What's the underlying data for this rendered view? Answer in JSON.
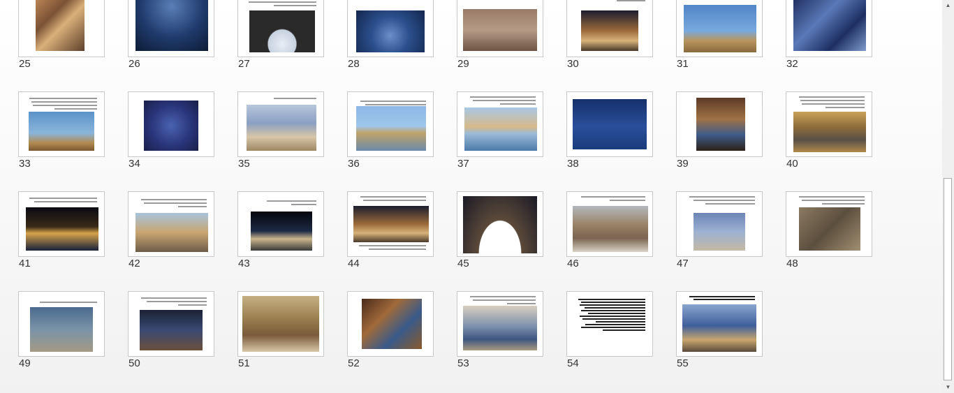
{
  "slides": [
    {
      "number": "25"
    },
    {
      "number": "26"
    },
    {
      "number": "27"
    },
    {
      "number": "28"
    },
    {
      "number": "29"
    },
    {
      "number": "30"
    },
    {
      "number": "31"
    },
    {
      "number": "32"
    },
    {
      "number": "33"
    },
    {
      "number": "34"
    },
    {
      "number": "35"
    },
    {
      "number": "36"
    },
    {
      "number": "37"
    },
    {
      "number": "38"
    },
    {
      "number": "39"
    },
    {
      "number": "40"
    },
    {
      "number": "41"
    },
    {
      "number": "42"
    },
    {
      "number": "43"
    },
    {
      "number": "44"
    },
    {
      "number": "45"
    },
    {
      "number": "46"
    },
    {
      "number": "47"
    },
    {
      "number": "48"
    },
    {
      "number": "49"
    },
    {
      "number": "50"
    },
    {
      "number": "51"
    },
    {
      "number": "52"
    },
    {
      "number": "53"
    },
    {
      "number": "54"
    },
    {
      "number": "55"
    }
  ],
  "scrollbar": {
    "up_icon": "▲",
    "down_icon": "▼"
  }
}
